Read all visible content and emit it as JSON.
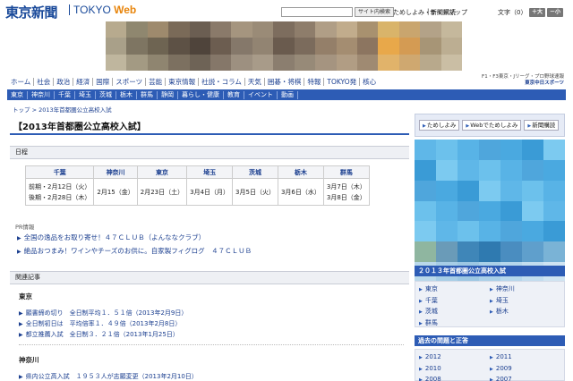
{
  "header": {
    "logo": "東京新聞",
    "logo_sub_text": "TOKYO",
    "logo_sub_accent": "Web",
    "search_button": "サイト内検索",
    "links": [
      "ためしよみ・新聞購読",
      "サイトマップ"
    ],
    "fontsize_label": "文字（0）",
    "font_plus": "＋大",
    "font_minus": "－小"
  },
  "nav": {
    "items": [
      "ホーム",
      "社会",
      "政治",
      "経済",
      "国際",
      "スポーツ",
      "芸能",
      "東京情報",
      "社説・コラム",
      "天気",
      "囲碁・将棋",
      "特報",
      "TOKYO発",
      "核心"
    ],
    "sponsor_line1": "F1・F3東京・Jリーグ・プロ野球速報",
    "sponsor_line2": "東京中日スポーツ"
  },
  "subnav": {
    "items": [
      "東京",
      "神奈川",
      "千葉",
      "埼玉",
      "茨城",
      "栃木",
      "群馬",
      "静岡",
      "暮らし・健康",
      "教育",
      "イベント",
      "動画"
    ]
  },
  "breadcrumb": {
    "home": "トップ",
    "separator": ">",
    "current": "2013年首都圏公立高校入試"
  },
  "article": {
    "title": "【2013年首都圏公立高校入試】",
    "schedule_heading": "日程",
    "schedule": {
      "headers": [
        "千葉",
        "神奈川",
        "東京",
        "埼玉",
        "茨城",
        "栃木",
        "群馬"
      ],
      "chiba_line1": "前期・2月12日（火）",
      "chiba_line2": "後期・2月28日（木）",
      "kanagawa": "2月15（金）",
      "tokyo": "2月23日（土）",
      "saitama": "3月4日（月）",
      "ibaraki": "3月5日（火）",
      "tochigi": "3月6日（水）",
      "gunma_line1": "3月7日（木）",
      "gunma_line2": "3月8日（金）"
    },
    "pr_label": "PR情報",
    "pr_links": [
      "全国の逸品をお取り寄せ！４７ＣＬＵＢ（よんななクラブ）",
      "絶品おつまみ！ワインやチーズのお供に。自家製フィグログ　４７ＣＬＵＢ"
    ],
    "related_heading": "関連記事",
    "regions": [
      "東京",
      "神奈川"
    ],
    "tokyo_links": [
      "願書締め切り　全日制平均１．５１倍（2013年2月9日）",
      "全日制初日は　平均倍率１．４９倍（2013年2月8日）",
      "都立推薦入試　全日制３．２１倍（2013年1月25日）"
    ],
    "kanagawa_links": [
      "県内公立高入試　１９５３人が志願変更（2013年2月10日）"
    ]
  },
  "sidebar": {
    "buttons": [
      "ためしよみ",
      "Webでためしよみ",
      "新聞購読"
    ],
    "heading_1": "２０１３年首都圏公立高校入試",
    "prefectures": [
      "東京",
      "神奈川",
      "千葉",
      "埼玉",
      "茨城",
      "栃木",
      "群馬"
    ],
    "heading_2": "過去の問題と正答",
    "years": [
      "2012",
      "2011",
      "2010",
      "2009",
      "2008",
      "2007"
    ]
  }
}
